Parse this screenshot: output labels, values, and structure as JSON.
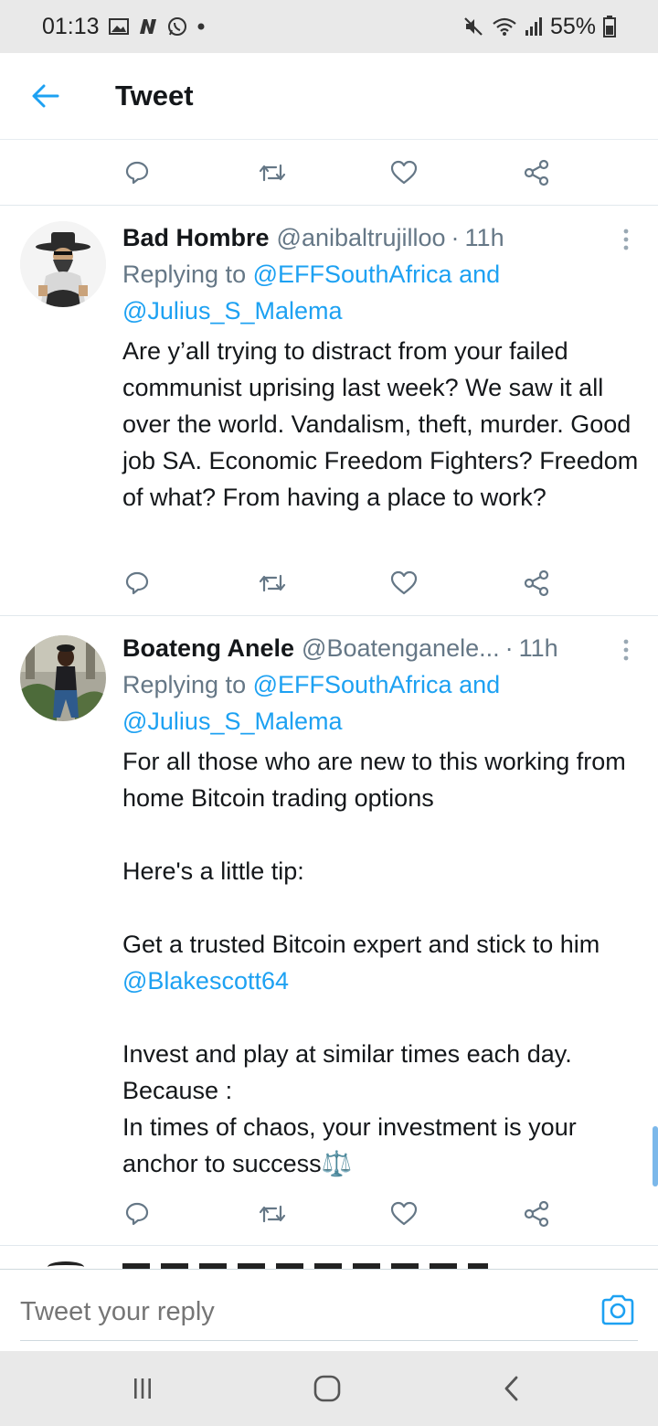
{
  "status_bar": {
    "time": "01:13",
    "battery": "55%",
    "icons_left": [
      "gallery-icon",
      "n-app-icon",
      "whatsapp-icon",
      "dot-icon"
    ],
    "icons_right": [
      "mute-icon",
      "wifi-icon",
      "signal-icon",
      "battery-icon"
    ]
  },
  "header": {
    "title": "Tweet"
  },
  "tweets": [
    {
      "display_name": "Bad Hombre",
      "handle": "@anibaltrujilloo",
      "time": "11h",
      "replying_prefix": "Replying to ",
      "replying_to_1": "@EFFSouthAfrica",
      "replying_and": " and",
      "replying_to_2": "@Julius_S_Malema",
      "text": "Are y’all trying to distract from your failed communist uprising last week? We saw it all over the world. Vandalism, theft, murder. Good job SA. Economic Freedom Fighters? Freedom of what? From having a place to work?"
    },
    {
      "display_name": "Boateng Anele",
      "handle": "@Boatenganele...",
      "time": "11h",
      "replying_prefix": "Replying to ",
      "replying_to_1": "@EFFSouthAfrica",
      "replying_and": " and",
      "replying_to_2": "@Julius_S_Malema",
      "text_p1": "For all those who are new to this working from home Bitcoin trading options",
      "text_p2": "Here's a little tip:",
      "text_p3": "Get a trusted Bitcoin expert and stick to him ",
      "text_p3_mention": "@Blakescott64",
      "text_p4a": "Invest and play at similar times each day.",
      "text_p4b": "Because :",
      "text_p4c": "In times of chaos, your investment is your anchor to success",
      "text_p4_emoji": "⚖️"
    }
  ],
  "reply": {
    "placeholder": "Tweet your reply"
  },
  "colors": {
    "accent": "#1da1f2",
    "secondary_text": "#657786",
    "divider": "#e1e8ed"
  }
}
